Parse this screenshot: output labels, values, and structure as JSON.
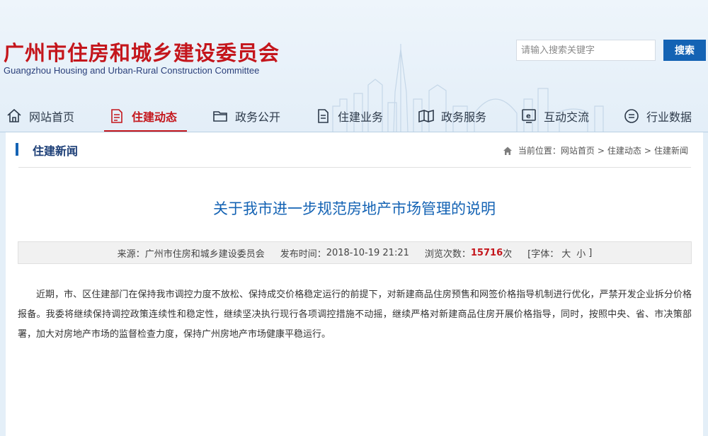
{
  "header": {
    "title_cn": "广州市住房和城乡建设委员会",
    "title_en": "Guangzhou Housing and Urban-Rural Construction Committee"
  },
  "search": {
    "placeholder": "请输入搜索关键字",
    "button_label": "搜索"
  },
  "nav": {
    "items": [
      {
        "label": "网站首页",
        "icon": "home-icon"
      },
      {
        "label": "住建动态",
        "icon": "document-icon",
        "active": true
      },
      {
        "label": "政务公开",
        "icon": "folder-icon"
      },
      {
        "label": "住建业务",
        "icon": "file-icon"
      },
      {
        "label": "政务服务",
        "icon": "service-icon"
      },
      {
        "label": "互动交流",
        "icon": "e-interact-icon"
      },
      {
        "label": "行业数据",
        "icon": "data-icon"
      }
    ],
    "active_color": "#c4161c"
  },
  "section": {
    "title": "住建新闻"
  },
  "breadcrumb": {
    "prefix": "当前位置：",
    "items": [
      "网站首页",
      "住建动态",
      "住建新闻"
    ],
    "separator": ">"
  },
  "article": {
    "title": "关于我市进一步规范房地产市场管理的说明",
    "meta": {
      "source_label": "来源：",
      "source": "广州市住房和城乡建设委员会",
      "date_label": "发布时间：",
      "date": "2018-10-19 21:21",
      "views_label": "浏览次数：",
      "views": "15716",
      "views_unit": "次",
      "font_label": "[字体：",
      "font_large": "大",
      "font_small": "小",
      "font_close": "]"
    },
    "body": "近期，市、区住建部门在保持我市调控力度不放松、保持成交价格稳定运行的前提下，对新建商品住房预售和网签价格指导机制进行优化，严禁开发企业拆分价格报备。我委将继续保持调控政策连续性和稳定性，继续坚决执行现行各项调控措施不动摇，继续严格对新建商品住房开展价格指导，同时，按照中央、省、市决策部署，加大对房地产市场的监督检查力度，保持广州房地产市场健康平稳运行。"
  },
  "colors": {
    "brand_red": "#c4161c",
    "brand_blue": "#1463b4",
    "page_bg": "#e4eff8"
  }
}
